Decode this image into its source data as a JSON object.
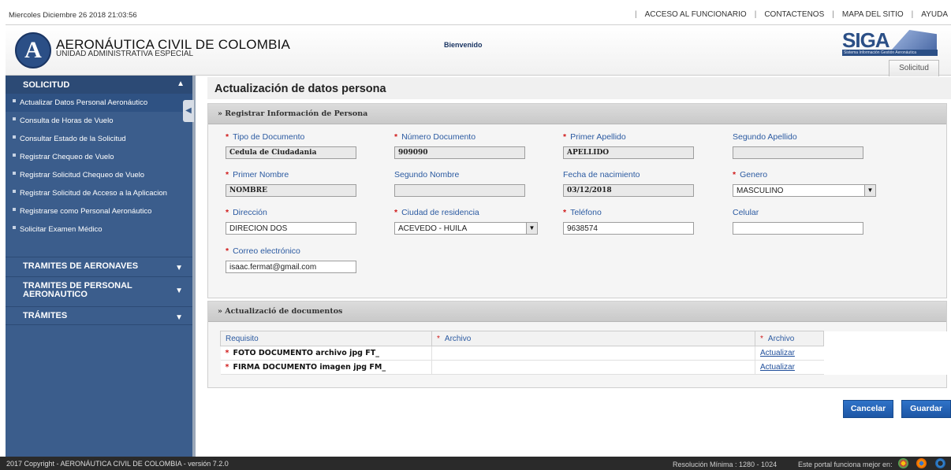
{
  "topbar": {
    "date": "Miercoles Diciembre 26 2018 21:03:56",
    "links": [
      "ACCESO AL FUNCIONARIO",
      "CONTACTENOS",
      "MAPA DEL SITIO",
      "AYUDA"
    ]
  },
  "header": {
    "logo_letter": "A",
    "org_name": "AERONÁUTICA CIVIL DE COLOMBIA",
    "org_subtitle": "UNIDAD ADMINISTRATIVA ESPECIAL",
    "welcome": "Bienvenido",
    "siga_logo": "SIGA",
    "siga_subtitle": "Sistema Información Gestión Aeronáutica",
    "tab": "Solicitud"
  },
  "sidebar": {
    "section_title": "SOLICITUD",
    "items": [
      "Actualizar Datos Personal Aeronáutico",
      "Consulta de Horas de Vuelo",
      "Consultar Estado de la Solicitud",
      "Registrar Chequeo de Vuelo",
      "Registrar Solicitud Chequeo de Vuelo",
      "Registrar Solicitud de Acceso a la Aplicacion",
      "Registrarse como Personal Aeronáutico",
      "Solicitar Examen Médico"
    ],
    "groups": [
      "TRAMITES DE AERONAVES",
      "TRAMITES DE PERSONAL AERONAUTICO",
      "TRÁMITES"
    ]
  },
  "main": {
    "title": "Actualización de datos persona",
    "panel1_title": "Registrar Información de Persona",
    "fields": {
      "tipo_doc": {
        "label": "Tipo de Documento",
        "value": "Cedula de Ciudadania"
      },
      "num_doc": {
        "label": "Número Documento",
        "value": "909090"
      },
      "primer_apellido": {
        "label": "Primer Apellido",
        "value": "APELLIDO"
      },
      "segundo_apellido": {
        "label": "Segundo Apellido",
        "value": ""
      },
      "primer_nombre": {
        "label": "Primer Nombre",
        "value": "NOMBRE"
      },
      "segundo_nombre": {
        "label": "Segundo Nombre",
        "value": ""
      },
      "fecha_nac": {
        "label": "Fecha de nacimiento",
        "value": "03/12/2018"
      },
      "genero": {
        "label": "Genero",
        "value": "MASCULINO"
      },
      "direccion": {
        "label": "Dirección",
        "value": "DIRECION DOS"
      },
      "ciudad": {
        "label": "Ciudad de residencia",
        "value": "ACEVEDO - HUILA"
      },
      "telefono": {
        "label": "Teléfono",
        "value": "9638574"
      },
      "celular": {
        "label": "Celular",
        "value": ""
      },
      "correo": {
        "label": "Correo electrónico",
        "value": "isaac.fermat@gmail.com"
      }
    },
    "panel2_title": "Actualizació de documentos",
    "docs_headers": [
      "Requisito",
      "Archivo",
      "Archivo"
    ],
    "docs_rows": [
      {
        "requisito": "FOTO DOCUMENTO archivo jpg FT_",
        "action": "Actualizar"
      },
      {
        "requisito": "FIRMA DOCUMENTO imagen jpg FM_",
        "action": "Actualizar"
      }
    ],
    "cancel_label": "Cancelar",
    "save_label": "Guardar"
  },
  "footer": {
    "copyright": "2017 Copyright - AERONÁUTICA CIVIL DE COLOMBIA - versión 7.2.0",
    "resolution": "Resolución Mínima : 1280 - 1024",
    "best_viewed": "Este portal funciona mejor en:"
  }
}
